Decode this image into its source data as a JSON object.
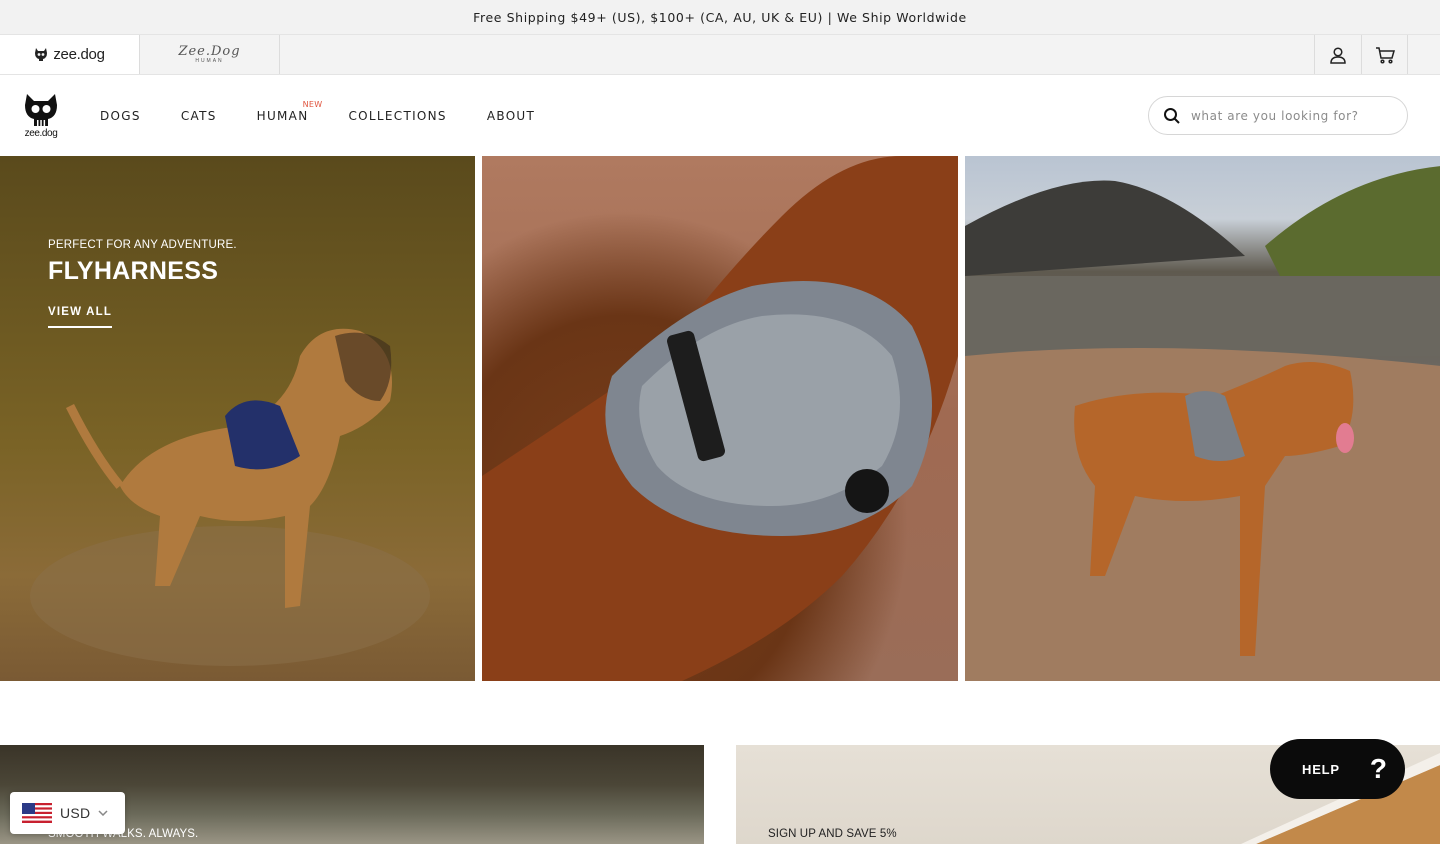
{
  "announcement": "Free Shipping $49+ (US), $100+ (CA, AU, UK & EU) | We Ship Worldwide",
  "brands": {
    "zeedog": "zee.dog",
    "human_script": "Zee.Dog",
    "human_sub": "HUMAN"
  },
  "logo_word": "zee.dog",
  "nav": {
    "items": [
      "DOGS",
      "CATS",
      "HUMAN",
      "COLLECTIONS",
      "ABOUT"
    ],
    "new_badge": "NEW"
  },
  "search": {
    "placeholder": "what are you looking for?"
  },
  "hero": {
    "kicker": "PERFECT FOR ANY ADVENTURE.",
    "title": "FLYHARNESS",
    "cta": "VIEW ALL"
  },
  "cards": {
    "left_label": "SMOOTH WALKS. ALWAYS.",
    "right_label": "SIGN UP AND SAVE 5%"
  },
  "currency": {
    "code": "USD"
  },
  "help": {
    "label": "HELP",
    "glyph": "?"
  },
  "colors": {
    "new_badge": "#e0553f",
    "help_bg": "#0b0b0b",
    "announcement_bg": "#f2f2f2"
  }
}
